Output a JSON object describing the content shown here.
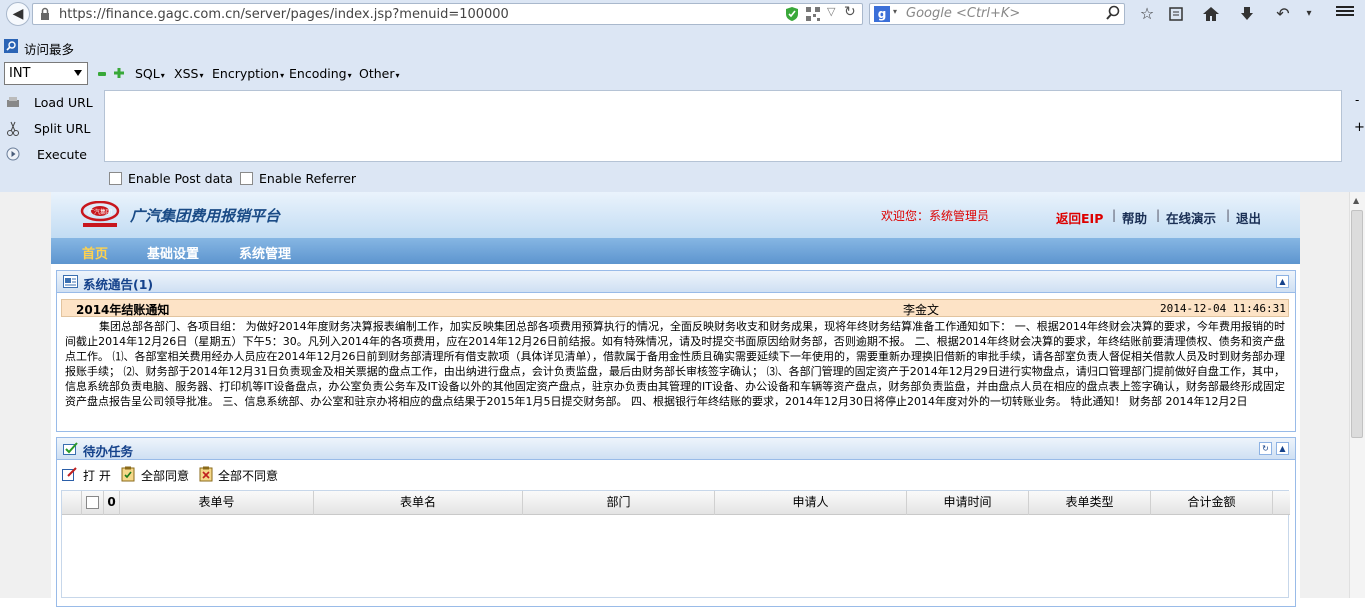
{
  "browser": {
    "url": "https://finance.gagc.com.cn/server/pages/index.jsp?menuid=100000",
    "search_placeholder": "Google <Ctrl+K>",
    "bookmark_label": "访问最多"
  },
  "hackbar": {
    "type_select": "INT",
    "menus": [
      "SQL",
      "XSS",
      "Encryption",
      "Encoding",
      "Other"
    ],
    "load_url": "Load URL",
    "split_url": "Split URL",
    "execute": "Execute",
    "url_value": "",
    "enable_post": "Enable Post data",
    "enable_referrer": "Enable Referrer",
    "side_minus": "-",
    "side_plus": "+"
  },
  "app": {
    "title": "广汽集团费用报销平台",
    "welcome": "欢迎您：系统管理员",
    "links": {
      "return_eip": "返回EIP",
      "help": "帮助",
      "demo": "在线演示",
      "logout": "退出",
      "sep": "|"
    },
    "nav": [
      "首页",
      "基础设置",
      "系统管理"
    ],
    "logo_text": "广汽集团"
  },
  "notice_panel": {
    "title": "系统通告(1)",
    "notice": {
      "title": "2014年结账通知",
      "author": "李金文",
      "time": "2014-12-04 11:46:31",
      "body": "集团总部各部门、各项目组：  为做好2014年度财务决算报表编制工作，加实反映集团总部各项费用预算执行的情况，全面反映财务收支和财务成果，现将年终财务结算准备工作通知如下：  一、根据2014年终财会决算的要求，今年费用报销的时间截止2014年12月26日（星期五）下午5：30。凡列入2014年的各项费用，应在2014年12月26日前结报。如有特殊情况，请及时提交书面原因给财务部，否则逾期不报。  二、根据2014年终财会决算的要求，年终结账前要清理债权、债务和资产盘点工作。 ⑴、各部室相关费用经办人员应在2014年12月26日前到财务部清理所有借支款项（具体详见清单），借款属于备用金性质且确实需要延续下一年使用的，需要重新办理换旧借新的审批手续，请各部室负责人督促相关借款人员及时到财务部办理报账手续；  ⑵、财务部于2014年12月31日负责现金及相关票据的盘点工作，由出纳进行盘点，会计负责监盘，最后由财务部长审核签字确认；  ⑶、各部门管理的固定资产于2014年12月29日进行实物盘点，请归口管理部门提前做好自盘工作，其中，信息系统部负责电脑、服务器、打印机等IT设备盘点，办公室负责公务车及IT设备以外的其他固定资产盘点，驻京办负责由其管理的IT设备、办公设备和车辆等资产盘点，财务部负责监盘，并由盘点人员在相应的盘点表上签字确认，财务部最终形成固定资产盘点报告呈公司领导批准。  三、信息系统部、办公室和驻京办将相应的盘点结果于2015年1月5日提交财务部。  四、根据银行年终结账的要求，2014年12月30日将停止2014年度对外的一切转账业务。  特此通知！  财务部  2014年12月2日"
    }
  },
  "todo_panel": {
    "title": "待办任务",
    "tools": {
      "open": "打 开",
      "approve_all": "全部同意",
      "reject_all": "全部不同意"
    },
    "columns": [
      "表单号",
      "表单名",
      "部门",
      "申请人",
      "申请时间",
      "表单类型",
      "合计金额"
    ],
    "attach_header": "0",
    "rows": []
  }
}
